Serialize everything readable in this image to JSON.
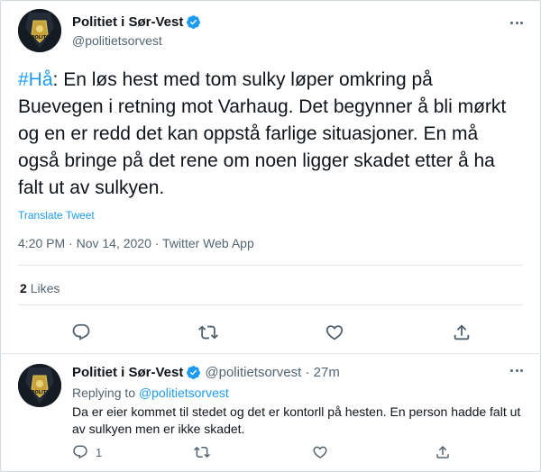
{
  "main_tweet": {
    "author_name": "Politiet i Sør-Vest",
    "handle": "@politietsorvest",
    "hashtag": "#Hå",
    "text_rest": ": En løs hest med tom sulky løper omkring på Buevegen i retning mot Varhaug. Det begynner å bli mørkt og en er redd det kan oppstå farlige situasjoner. En må også bringe på det rene om noen ligger skadet etter å ha falt ut av sulkyen.",
    "translate_label": "Translate Tweet",
    "meta": "4:20 PM · Nov 14, 2020 · Twitter Web App",
    "likes_count": "2",
    "likes_label": "Likes",
    "avatar_text": "POLITI",
    "icons": [
      "reply-icon",
      "retweet-icon",
      "like-icon",
      "share-icon",
      "verified-badge-icon",
      "more-icon"
    ]
  },
  "reply_tweet": {
    "author_name": "Politiet i Sør-Vest",
    "handle_time": "@politietsorvest · 27m",
    "replying_prefix": "Replying to",
    "replying_to": "@politietsorvest",
    "text": "Da er eier kommet til stedet og det er kontorll på hesten. En person hadde falt ut av sulkyen men er ikke skadet.",
    "reply_count": "1",
    "avatar_text": "POLITI"
  },
  "colors": {
    "accent": "#1d9bf0",
    "secondary_text": "#536471",
    "primary_text": "#0f1419",
    "divider": "#e1e8ed"
  }
}
